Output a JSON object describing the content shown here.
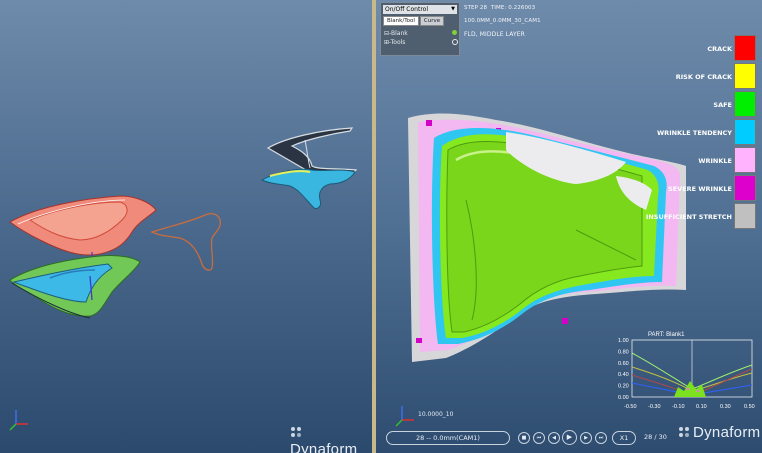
{
  "left_view": {
    "logo": "Dynaform",
    "axes": {
      "x": "X",
      "y": "Y",
      "z": "Z"
    }
  },
  "right_view": {
    "control": {
      "dropdown": "On/Off Control",
      "tabs": [
        "Blank/Tool",
        "Curve"
      ],
      "tree": [
        {
          "label": "Blank",
          "indicator_color": "#7fd13b"
        },
        {
          "label": "Tools",
          "indicator_color": "#e8e8e8"
        }
      ]
    },
    "info": {
      "step": "STEP 28",
      "time": "TIME: 0.226003",
      "case": "100.0MM_0.0MM_30_CAM1",
      "result": "FLD, MIDDLE LAYER"
    },
    "legend": [
      {
        "label": "CRACK",
        "color": "#ff0000"
      },
      {
        "label": "RISK OF CRACK",
        "color": "#ffff00"
      },
      {
        "label": "SAFE",
        "color": "#00ee00"
      },
      {
        "label": "WRINKLE TENDENCY",
        "color": "#00ccff"
      },
      {
        "label": "WRINKLE",
        "color": "#ffb3ff"
      },
      {
        "label": "SEVERE WRINKLE",
        "color": "#dd00cc"
      },
      {
        "label": "INSUFFICIENT STRETCH",
        "color": "#c0c0c0"
      }
    ],
    "fld": {
      "title": "PART: Blank1",
      "y_ticks": [
        "1.00",
        "0.80",
        "0.60",
        "0.40",
        "0.20",
        "0.00"
      ],
      "x_ticks": [
        "-0.50",
        "-0.30",
        "-0.10",
        "0.10",
        "0.30",
        "0.50"
      ]
    },
    "playback": {
      "field": "28 -- 0.0mm(CAM1)",
      "buttons": [
        "stop",
        "first",
        "prev",
        "play",
        "next",
        "last"
      ],
      "speed": "X1",
      "frame": "28 / 30"
    },
    "axis_label": "10.0000_10",
    "logo": "Dynaform"
  }
}
